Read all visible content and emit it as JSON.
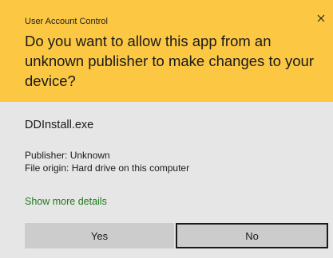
{
  "dialog": {
    "header": {
      "title": "User Account Control",
      "question": "Do you want to allow this app from an unknown publisher to make changes to your device?",
      "background_color": "#fcc843",
      "close_icon": "close-icon"
    },
    "body": {
      "app_name": "DDInstall.exe",
      "publisher": "Publisher: Unknown",
      "file_origin": "File origin: Hard drive on this computer",
      "more_details_link": "Show more details",
      "link_color": "#1e7a1e"
    },
    "buttons": {
      "yes_label": "Yes",
      "no_label": "No"
    }
  }
}
